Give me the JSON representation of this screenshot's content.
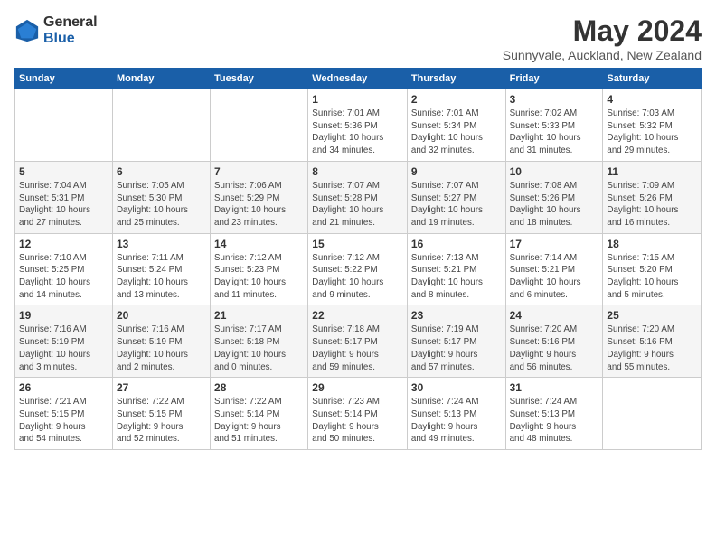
{
  "logo": {
    "general": "General",
    "blue": "Blue"
  },
  "header": {
    "month_title": "May 2024",
    "location": "Sunnyvale, Auckland, New Zealand"
  },
  "weekdays": [
    "Sunday",
    "Monday",
    "Tuesday",
    "Wednesday",
    "Thursday",
    "Friday",
    "Saturday"
  ],
  "weeks": [
    [
      {
        "day": "",
        "info": ""
      },
      {
        "day": "",
        "info": ""
      },
      {
        "day": "",
        "info": ""
      },
      {
        "day": "1",
        "info": "Sunrise: 7:01 AM\nSunset: 5:36 PM\nDaylight: 10 hours\nand 34 minutes."
      },
      {
        "day": "2",
        "info": "Sunrise: 7:01 AM\nSunset: 5:34 PM\nDaylight: 10 hours\nand 32 minutes."
      },
      {
        "day": "3",
        "info": "Sunrise: 7:02 AM\nSunset: 5:33 PM\nDaylight: 10 hours\nand 31 minutes."
      },
      {
        "day": "4",
        "info": "Sunrise: 7:03 AM\nSunset: 5:32 PM\nDaylight: 10 hours\nand 29 minutes."
      }
    ],
    [
      {
        "day": "5",
        "info": "Sunrise: 7:04 AM\nSunset: 5:31 PM\nDaylight: 10 hours\nand 27 minutes."
      },
      {
        "day": "6",
        "info": "Sunrise: 7:05 AM\nSunset: 5:30 PM\nDaylight: 10 hours\nand 25 minutes."
      },
      {
        "day": "7",
        "info": "Sunrise: 7:06 AM\nSunset: 5:29 PM\nDaylight: 10 hours\nand 23 minutes."
      },
      {
        "day": "8",
        "info": "Sunrise: 7:07 AM\nSunset: 5:28 PM\nDaylight: 10 hours\nand 21 minutes."
      },
      {
        "day": "9",
        "info": "Sunrise: 7:07 AM\nSunset: 5:27 PM\nDaylight: 10 hours\nand 19 minutes."
      },
      {
        "day": "10",
        "info": "Sunrise: 7:08 AM\nSunset: 5:26 PM\nDaylight: 10 hours\nand 18 minutes."
      },
      {
        "day": "11",
        "info": "Sunrise: 7:09 AM\nSunset: 5:26 PM\nDaylight: 10 hours\nand 16 minutes."
      }
    ],
    [
      {
        "day": "12",
        "info": "Sunrise: 7:10 AM\nSunset: 5:25 PM\nDaylight: 10 hours\nand 14 minutes."
      },
      {
        "day": "13",
        "info": "Sunrise: 7:11 AM\nSunset: 5:24 PM\nDaylight: 10 hours\nand 13 minutes."
      },
      {
        "day": "14",
        "info": "Sunrise: 7:12 AM\nSunset: 5:23 PM\nDaylight: 10 hours\nand 11 minutes."
      },
      {
        "day": "15",
        "info": "Sunrise: 7:12 AM\nSunset: 5:22 PM\nDaylight: 10 hours\nand 9 minutes."
      },
      {
        "day": "16",
        "info": "Sunrise: 7:13 AM\nSunset: 5:21 PM\nDaylight: 10 hours\nand 8 minutes."
      },
      {
        "day": "17",
        "info": "Sunrise: 7:14 AM\nSunset: 5:21 PM\nDaylight: 10 hours\nand 6 minutes."
      },
      {
        "day": "18",
        "info": "Sunrise: 7:15 AM\nSunset: 5:20 PM\nDaylight: 10 hours\nand 5 minutes."
      }
    ],
    [
      {
        "day": "19",
        "info": "Sunrise: 7:16 AM\nSunset: 5:19 PM\nDaylight: 10 hours\nand 3 minutes."
      },
      {
        "day": "20",
        "info": "Sunrise: 7:16 AM\nSunset: 5:19 PM\nDaylight: 10 hours\nand 2 minutes."
      },
      {
        "day": "21",
        "info": "Sunrise: 7:17 AM\nSunset: 5:18 PM\nDaylight: 10 hours\nand 0 minutes."
      },
      {
        "day": "22",
        "info": "Sunrise: 7:18 AM\nSunset: 5:17 PM\nDaylight: 9 hours\nand 59 minutes."
      },
      {
        "day": "23",
        "info": "Sunrise: 7:19 AM\nSunset: 5:17 PM\nDaylight: 9 hours\nand 57 minutes."
      },
      {
        "day": "24",
        "info": "Sunrise: 7:20 AM\nSunset: 5:16 PM\nDaylight: 9 hours\nand 56 minutes."
      },
      {
        "day": "25",
        "info": "Sunrise: 7:20 AM\nSunset: 5:16 PM\nDaylight: 9 hours\nand 55 minutes."
      }
    ],
    [
      {
        "day": "26",
        "info": "Sunrise: 7:21 AM\nSunset: 5:15 PM\nDaylight: 9 hours\nand 54 minutes."
      },
      {
        "day": "27",
        "info": "Sunrise: 7:22 AM\nSunset: 5:15 PM\nDaylight: 9 hours\nand 52 minutes."
      },
      {
        "day": "28",
        "info": "Sunrise: 7:22 AM\nSunset: 5:14 PM\nDaylight: 9 hours\nand 51 minutes."
      },
      {
        "day": "29",
        "info": "Sunrise: 7:23 AM\nSunset: 5:14 PM\nDaylight: 9 hours\nand 50 minutes."
      },
      {
        "day": "30",
        "info": "Sunrise: 7:24 AM\nSunset: 5:13 PM\nDaylight: 9 hours\nand 49 minutes."
      },
      {
        "day": "31",
        "info": "Sunrise: 7:24 AM\nSunset: 5:13 PM\nDaylight: 9 hours\nand 48 minutes."
      },
      {
        "day": "",
        "info": ""
      }
    ]
  ]
}
